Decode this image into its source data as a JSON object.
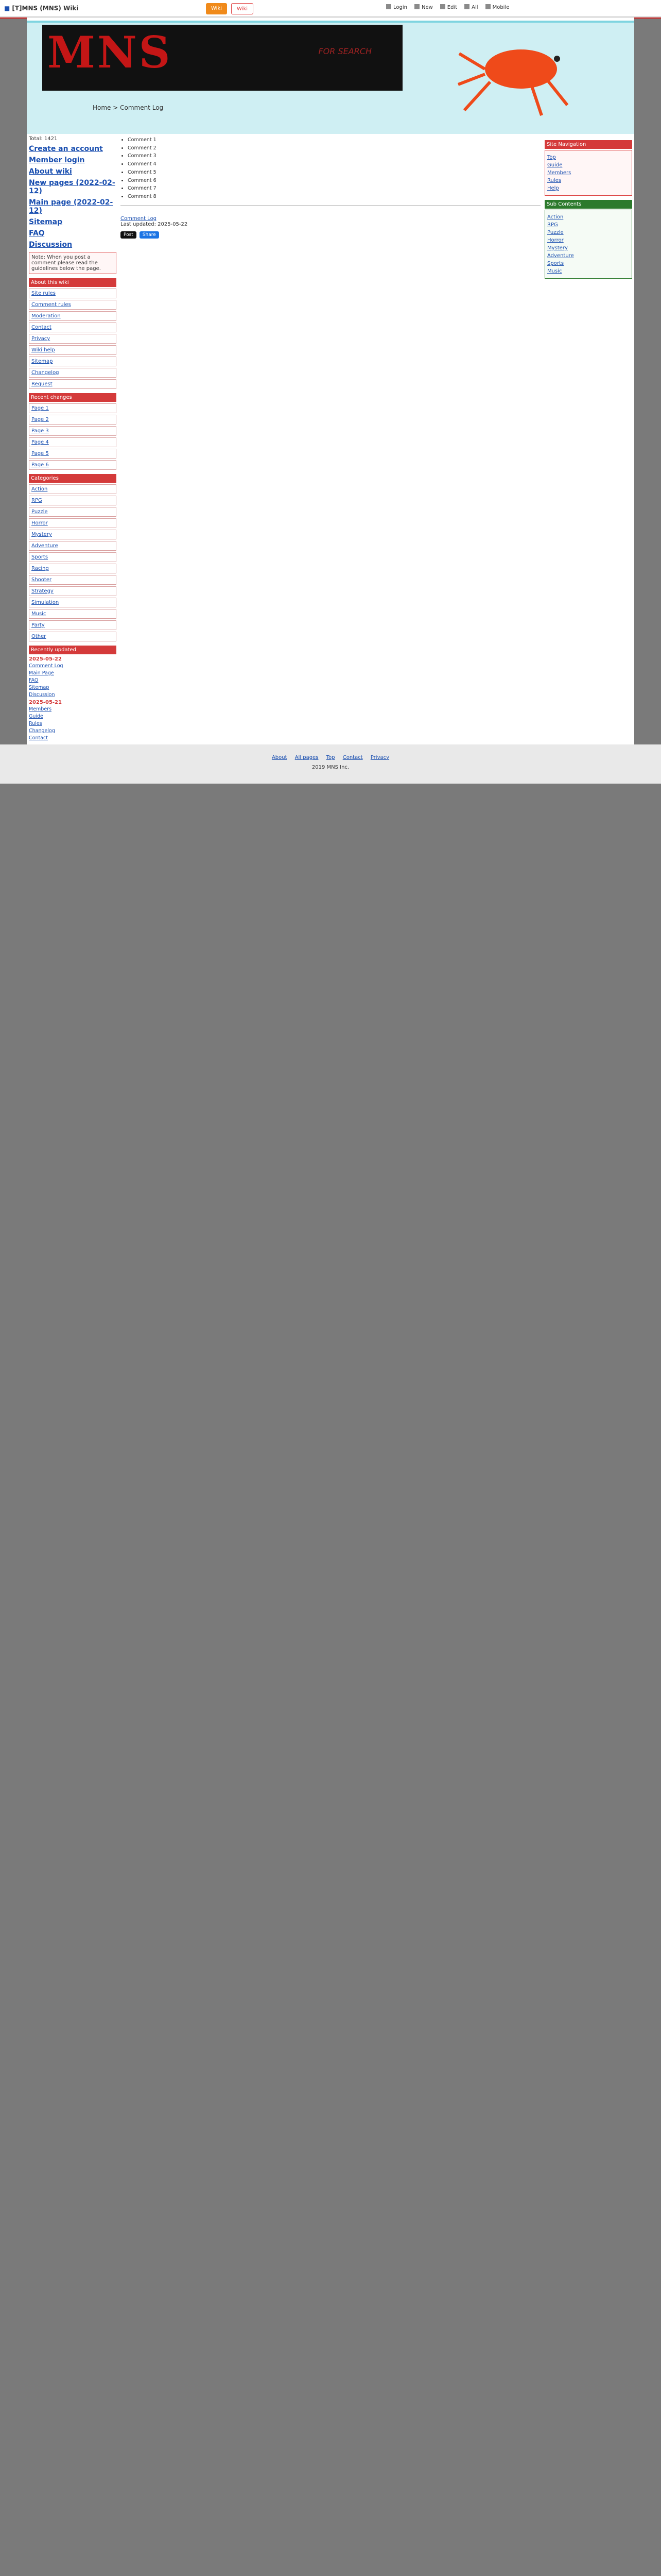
{
  "topbar": {
    "logo": "[T]MNS (MNS) Wiki",
    "buttons": [
      "Wiki",
      "Wiki"
    ],
    "tools": [
      "Login",
      "New",
      "Edit",
      "All",
      "Mobile"
    ]
  },
  "header": {
    "banner_title": "MNS",
    "banner_sub": "FOR SEARCH",
    "tagline": "Home > Comment Log"
  },
  "left": {
    "counter": "Total: 1421",
    "big_links": [
      "Create an account",
      "Member login",
      "About wiki",
      "New pages (2022-02-12)",
      "Main page (2022-02-12)",
      "Sitemap",
      "FAQ",
      "Discussion"
    ],
    "notice_text": "Note: When you post a comment please read the guidelines below the page.",
    "section_a": "About this wiki",
    "items_a": [
      "Site rules",
      "Comment rules",
      "Moderation",
      "Contact",
      "Privacy",
      "Wiki help",
      "Sitemap",
      "Changelog",
      "Request"
    ],
    "section_b": "Recent changes",
    "items_b": [
      "Page 1",
      "Page 2",
      "Page 3",
      "Page 4",
      "Page 5",
      "Page 6"
    ],
    "section_c": "Categories",
    "items_c": [
      "Action",
      "RPG",
      "Puzzle",
      "Horror",
      "Mystery",
      "Adventure",
      "Sports",
      "Racing",
      "Shooter",
      "Strategy",
      "Simulation",
      "Music",
      "Party",
      "Other"
    ],
    "section_d": "Recently updated",
    "recent": [
      "Comment Log",
      "Main Page",
      "FAQ",
      "Sitemap",
      "Discussion",
      "Members",
      "Guide",
      "Rules",
      "Changelog",
      "Contact"
    ],
    "date_a": "2025-05-22",
    "date_b": "2025-05-21"
  },
  "main": {
    "comments": [
      "Comment 1",
      "Comment 2",
      "Comment 3",
      "Comment 4",
      "Comment 5",
      "Comment 6",
      "Comment 7",
      "Comment 8"
    ],
    "page_link": "Comment Log",
    "updated": "Last updated: 2025-05-22",
    "share": [
      "Post",
      "Share"
    ]
  },
  "right": {
    "hdr": "Site Navigation",
    "items": [
      "Top",
      "Guide",
      "Members",
      "Rules",
      "Help"
    ],
    "hdr2": "Sub Contents",
    "items2": [
      "Action",
      "RPG",
      "Puzzle",
      "Horror",
      "Mystery",
      "Adventure",
      "Sports",
      "Music"
    ]
  },
  "footer": {
    "links": [
      "About",
      "All pages",
      "Top",
      "Contact",
      "Privacy"
    ],
    "copy": "2019 MNS Inc."
  },
  "colors": {
    "accent": "#d43a3a",
    "green": "#2c7a2c",
    "link": "#1a4fb0"
  }
}
